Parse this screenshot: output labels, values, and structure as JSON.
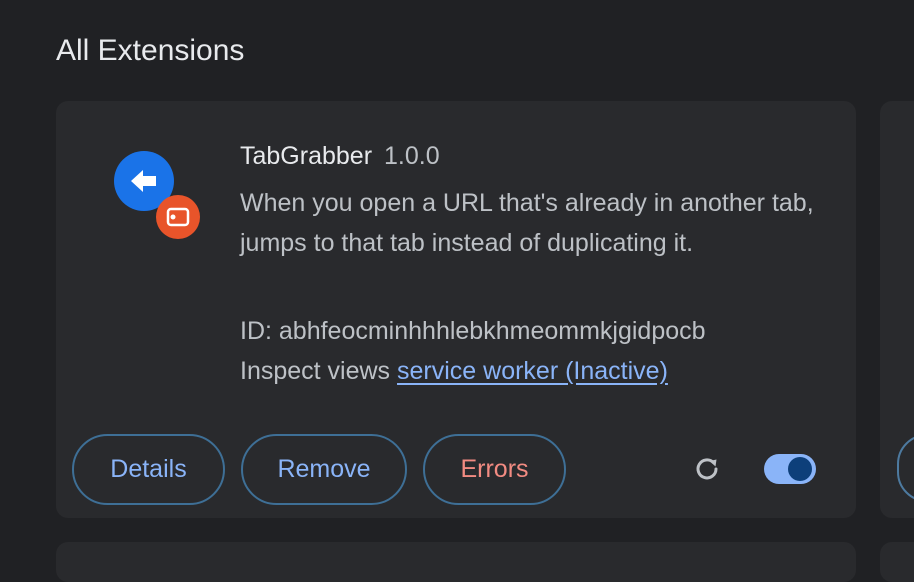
{
  "page": {
    "section_title": "All Extensions"
  },
  "extension": {
    "name": "TabGrabber",
    "version": "1.0.0",
    "description": "When you open a URL that's already in another tab, jumps to that tab instead of duplicating it.",
    "id_text": "ID: abhfeocminhhhlebkhmeommkjgidpocb",
    "inspect_label": "Inspect views",
    "inspect_link": "service worker (Inactive)",
    "enabled": true,
    "icon": "tabgrabber-logo-icon"
  },
  "actions": {
    "details_label": "Details",
    "remove_label": "Remove",
    "errors_label": "Errors",
    "reload_icon": "reload-icon"
  },
  "colors": {
    "background": "#202124",
    "card": "#292a2d",
    "accent": "#8ab4f8",
    "error": "#f28b82",
    "icon_blue": "#1a73e8",
    "icon_orange": "#e8542a"
  }
}
